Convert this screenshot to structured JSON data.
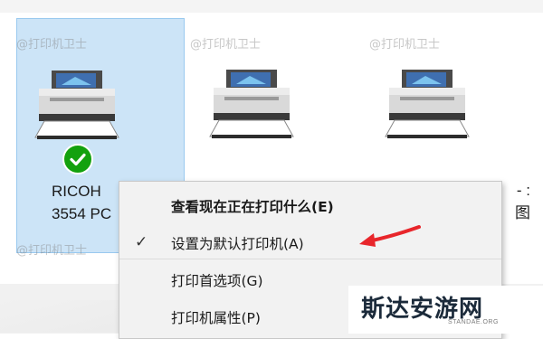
{
  "colors": {
    "selection_fill": "#cce4f7",
    "selection_border": "#99c9ef",
    "default_badge": "#13a10e",
    "menu_background": "#f2f2f2",
    "arrow": "#e8262b"
  },
  "watermark_text": "@打印机卫士",
  "printers": [
    {
      "name_line1": "RICOH",
      "name_line2": "3554 PC",
      "selected": true,
      "is_default": true,
      "icon": "printer-icon"
    },
    {
      "name_line1": "",
      "name_line2": "",
      "selected": false,
      "is_default": false,
      "icon": "printer-icon"
    },
    {
      "name_line1": "",
      "name_line2": "",
      "selected": false,
      "is_default": false,
      "icon": "printer-icon"
    }
  ],
  "partial_label": {
    "line1": "- :",
    "line2": "图"
  },
  "context_menu": {
    "items": [
      {
        "label": "查看现在正在打印什么(E)",
        "bold": true,
        "checked": false
      },
      {
        "label": "设置为默认打印机(A)",
        "bold": false,
        "checked": true
      },
      {
        "label": "打印首选项(G)",
        "bold": false,
        "checked": false
      },
      {
        "label": "打印机属性(P)",
        "bold": false,
        "checked": false
      }
    ],
    "check_glyph": "✓"
  },
  "site_logo": {
    "main": "斯达安游网",
    "sub": "STANDAE.ORG"
  }
}
